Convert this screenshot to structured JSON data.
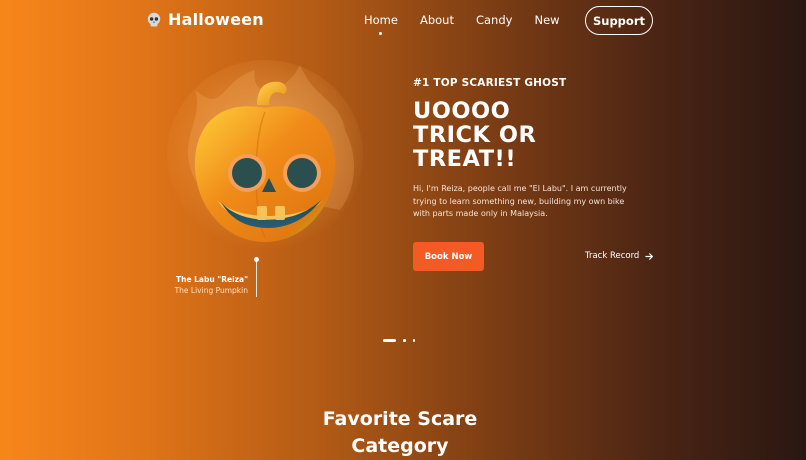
{
  "nav": {
    "brand": "Halloween",
    "links": [
      "Home",
      "About",
      "Candy",
      "New"
    ],
    "active": "Home",
    "support_label": "Support"
  },
  "hero": {
    "eyebrow": "#1 TOP SCARIEST GHOST",
    "headline_lines": [
      "UOOOO",
      "TRICK OR",
      "TREAT!!"
    ],
    "description": "Hi, I'm Reiza, people call me \"El Labu\". I am currently trying to learn something new, building my own bike with parts made only in Malaysia.",
    "book_label": "Book Now",
    "track_label": "Track Record",
    "caption_name": "The Labu \"Reiza\"",
    "caption_sub": "The Living Pumpkin"
  },
  "carousel": {
    "slides": 3,
    "active_index": 0
  },
  "section": {
    "title_lines": [
      "Favorite Scare",
      "Category"
    ]
  },
  "colors": {
    "bg_left": "#f7861a",
    "bg_right": "#2a1712",
    "button": "#f35a24",
    "pumpkin_orange": "#f08a18",
    "pumpkin_green": "#9ed629"
  },
  "icons": {
    "logo": "skull-icon",
    "arrow": "arrow-right-icon",
    "hero_image": "pumpkin-illustration"
  }
}
